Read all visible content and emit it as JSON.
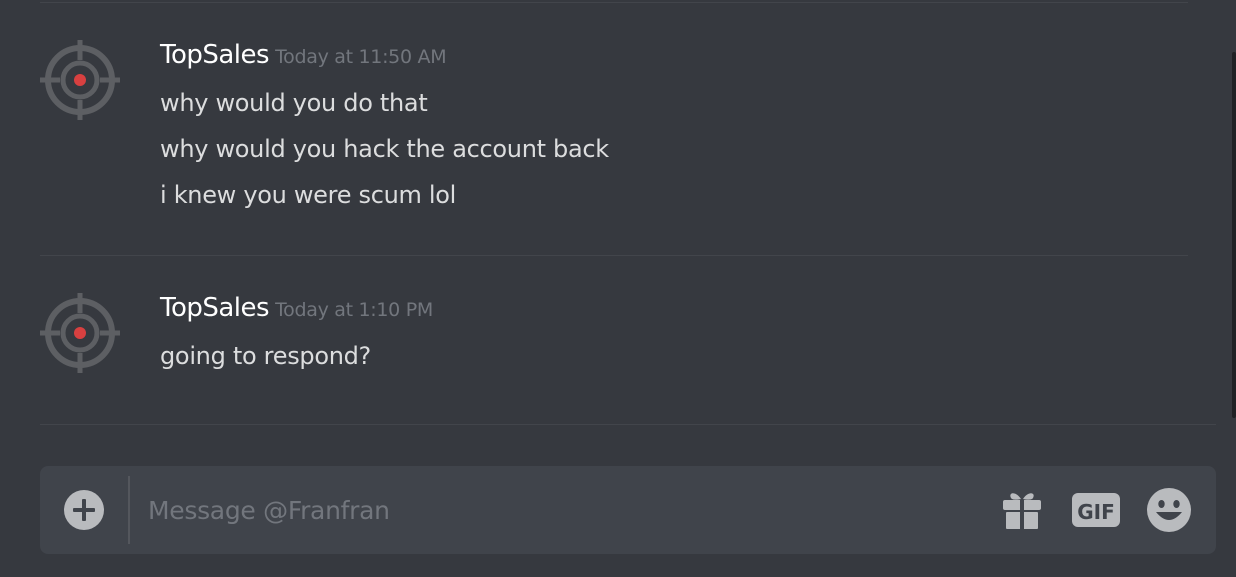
{
  "conversation": {
    "messages": [
      {
        "author": "TopSales",
        "timestamp": "Today at 11:50 AM",
        "lines": [
          "why would you do that",
          "why would you hack the account back",
          "i knew you were scum lol"
        ]
      },
      {
        "author": "TopSales",
        "timestamp": "Today at 1:10 PM",
        "lines": [
          "going to respond?"
        ]
      }
    ]
  },
  "composer": {
    "placeholder": "Message @Franfran",
    "value": "",
    "gif_label": "GIF"
  },
  "icons": {
    "avatar": "crosshair-target-icon",
    "attach": "plus-circle-icon",
    "gift": "gift-icon",
    "gif": "gif-icon",
    "emoji": "smiley-face-icon"
  },
  "colors": {
    "background": "#36393f",
    "composer_background": "#40444b",
    "username": "#ffffff",
    "message_text": "#dcddde",
    "timestamp": "#72767d",
    "avatar_dot": "#d84040",
    "avatar_ring": "#5d5f63"
  }
}
